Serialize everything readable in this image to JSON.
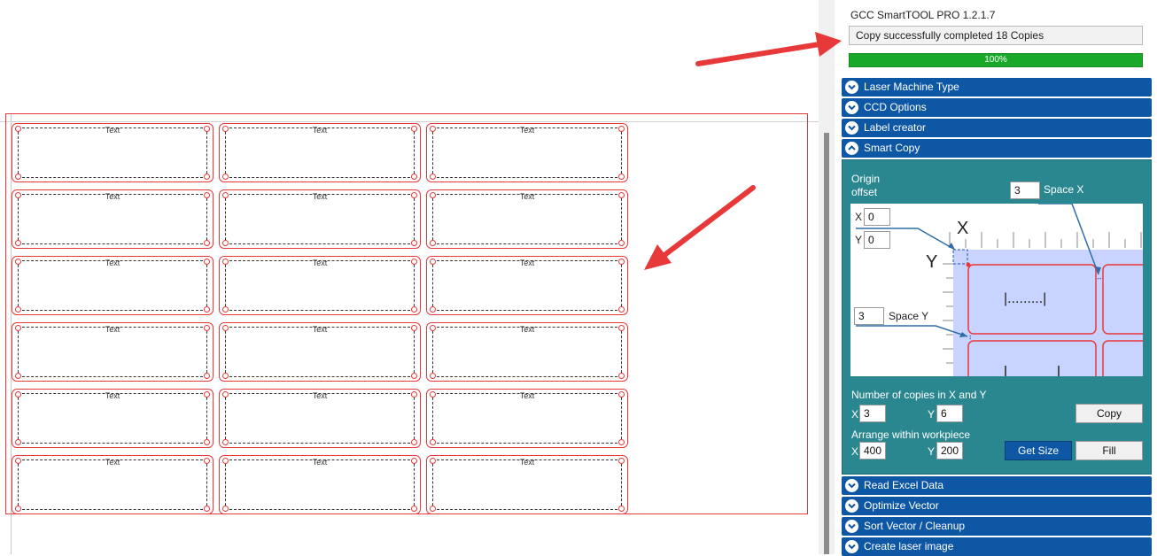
{
  "canvas": {
    "label_text": "Text",
    "rows": 6,
    "cols": 3
  },
  "panel": {
    "app_title": "GCC SmartTOOL PRO 1.2.1.7",
    "status_message": "Copy successfully completed 18 Copies",
    "progress": {
      "value_percent": 100,
      "label": "100%"
    },
    "sections_top": [
      {
        "title": "Laser Machine Type",
        "expanded": false
      },
      {
        "title": "CCD Options",
        "expanded": false
      },
      {
        "title": "Label creator",
        "expanded": false
      },
      {
        "title": "Smart Copy",
        "expanded": true
      }
    ],
    "sections_bottom": [
      {
        "title": "Read Excel Data",
        "expanded": false
      },
      {
        "title": "Optimize Vector",
        "expanded": false
      },
      {
        "title": "Sort Vector / Cleanup",
        "expanded": false
      },
      {
        "title": "Create laser image",
        "expanded": false
      }
    ]
  },
  "smart_copy": {
    "origin_label_1": "Origin",
    "origin_label_2": "offset",
    "origin_x_prefix": "X",
    "origin_x": "0",
    "origin_y_prefix": "Y",
    "origin_y": "0",
    "space_x_value": "3",
    "space_x_label": "Space X",
    "space_y_value": "3",
    "space_y_label": "Space Y",
    "diagram": {
      "axis_x": "X",
      "axis_y": "Y",
      "sample_text": "|.........|"
    },
    "copies_label": "Number of copies in X and Y",
    "copies_x_prefix": "X",
    "copies_x": "3",
    "copies_y_prefix": "Y",
    "copies_y": "6",
    "copy_button": "Copy",
    "arrange_label": "Arrange within workpiece",
    "arrange_x_prefix": "X",
    "arrange_x": "400",
    "arrange_y_prefix": "Y",
    "arrange_y": "200",
    "get_size_button": "Get Size",
    "fill_button": "Fill"
  },
  "colors": {
    "section_header": "#0e57a4",
    "smart_copy_bg": "#2a8790",
    "progress_fill": "#19a82a",
    "label_outline": "#e8393a",
    "annotation_arrow": "#e8393a",
    "diagram_blue": "#c8d3ff"
  }
}
